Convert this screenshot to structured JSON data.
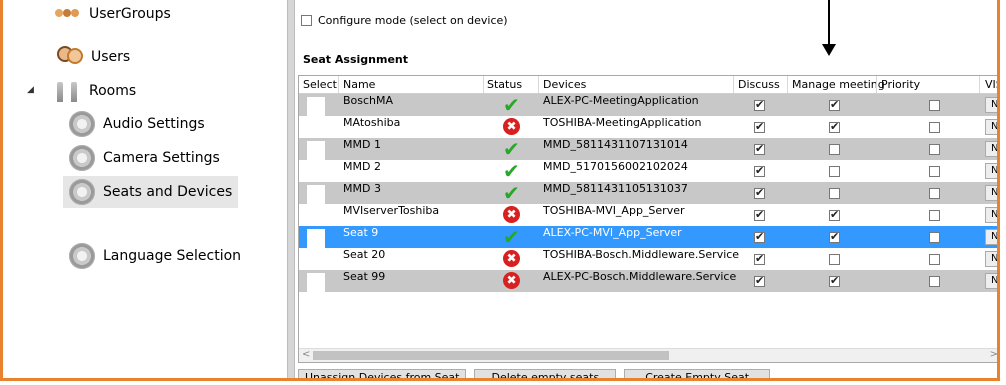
{
  "tree": {
    "items": [
      {
        "label": "UserGroups",
        "icon": "user-groups-icon"
      },
      {
        "label": "Users",
        "icon": "users-icon"
      },
      {
        "label": "Rooms",
        "icon": "rooms-icon",
        "expanded": true
      },
      {
        "label": "Audio Settings",
        "icon": "gear-icon"
      },
      {
        "label": "Camera Settings",
        "icon": "gear-icon"
      },
      {
        "label": "Seats and Devices",
        "icon": "gear-icon",
        "selected": true
      },
      {
        "label": "Language Selection",
        "icon": "gear-icon"
      }
    ]
  },
  "config_mode": {
    "label": "Configure mode (select on device)",
    "checked": false
  },
  "seat_assignment": {
    "title": "Seat Assignment",
    "columns": [
      "Select",
      "Name",
      "Status",
      "Devices",
      "Discuss",
      "Manage meeting",
      "Priority",
      "VIS"
    ],
    "rows": [
      {
        "name": "BoschMA",
        "status": "ok",
        "device": "ALEX-PC-MeetingApplication",
        "discuss": true,
        "manage": true,
        "priority": false,
        "vis": "None"
      },
      {
        "name": "MAtoshiba",
        "status": "error",
        "device": "TOSHIBA-MeetingApplication",
        "discuss": true,
        "manage": true,
        "priority": false,
        "vis": "None"
      },
      {
        "name": "MMD 1",
        "status": "ok",
        "device": "MMD_5811431107131014",
        "discuss": true,
        "manage": false,
        "priority": false,
        "vis": "None"
      },
      {
        "name": "MMD 2",
        "status": "ok",
        "device": "MMD_5170156002102024",
        "discuss": true,
        "manage": false,
        "priority": false,
        "vis": "None"
      },
      {
        "name": "MMD 3",
        "status": "ok",
        "device": "MMD_5811431105131037",
        "discuss": true,
        "manage": false,
        "priority": false,
        "vis": "None"
      },
      {
        "name": "MVIserverToshiba",
        "status": "error",
        "device": "TOSHIBA-MVI_App_Server",
        "discuss": true,
        "manage": true,
        "priority": false,
        "vis": "None"
      },
      {
        "name": "Seat 9",
        "status": "ok",
        "device": "ALEX-PC-MVI_App_Server",
        "discuss": true,
        "manage": true,
        "priority": false,
        "vis": "None",
        "selected": true
      },
      {
        "name": "Seat 20",
        "status": "error",
        "device": "TOSHIBA-Bosch.Middleware.Service",
        "discuss": true,
        "manage": false,
        "priority": false,
        "vis": "None"
      },
      {
        "name": "Seat 99",
        "status": "error",
        "device": "ALEX-PC-Bosch.Middleware.Service",
        "discuss": true,
        "manage": true,
        "priority": false,
        "vis": "None"
      }
    ]
  },
  "buttons": {
    "unassign": "Unassign Devices from Seat",
    "delete_empty": "Delete empty seats",
    "create_empty": "Create Empty Seat"
  },
  "colors": {
    "frame": "#e8822e",
    "selected_row": "#3399ff",
    "alt_row": "#c8c8c8"
  }
}
